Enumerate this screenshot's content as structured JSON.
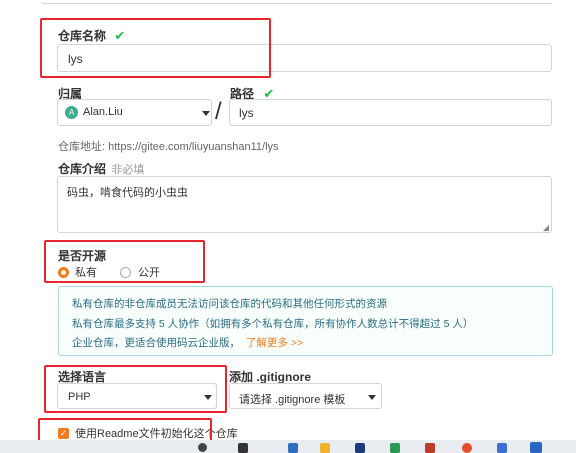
{
  "repo_name": {
    "label": "仓库名称",
    "value": "lys",
    "check": "✔"
  },
  "owner": {
    "label": "归属",
    "value": "Alan.Liu",
    "avatar_letter": "A"
  },
  "separator": "/",
  "path": {
    "label": "路径",
    "value": "lys",
    "check": "✔"
  },
  "repo_url": {
    "prefix": "仓库地址: ",
    "url": "https://gitee.com/liuyuanshan11/lys"
  },
  "intro": {
    "label": "仓库介绍",
    "optional": "非必填",
    "value": "码虫，啃食代码的小虫虫"
  },
  "visibility": {
    "label": "是否开源",
    "options": [
      {
        "label": "私有",
        "selected": true
      },
      {
        "label": "公开",
        "selected": false
      }
    ]
  },
  "info_box": {
    "line1": "私有仓库的非仓库成员无法访问该仓库的代码和其他任何形式的资源",
    "line2": "私有仓库最多支持 5 人协作（如拥有多个私有仓库，所有协作人数总计不得超过 5 人）",
    "line3": "企业仓库，更适合使用码云企业版，",
    "link": "了解更多 >>"
  },
  "language": {
    "label": "选择语言",
    "value": "PHP"
  },
  "gitignore": {
    "label": "添加 .gitignore",
    "value": "请选择 .gitignore 模板"
  },
  "readme": {
    "label": "使用Readme文件初始化这个仓库",
    "checked": true
  },
  "colors": {
    "accent": "#f37b1d",
    "highlight": "#e8262d",
    "check": "#21ba45",
    "link": "#f37b1d"
  }
}
